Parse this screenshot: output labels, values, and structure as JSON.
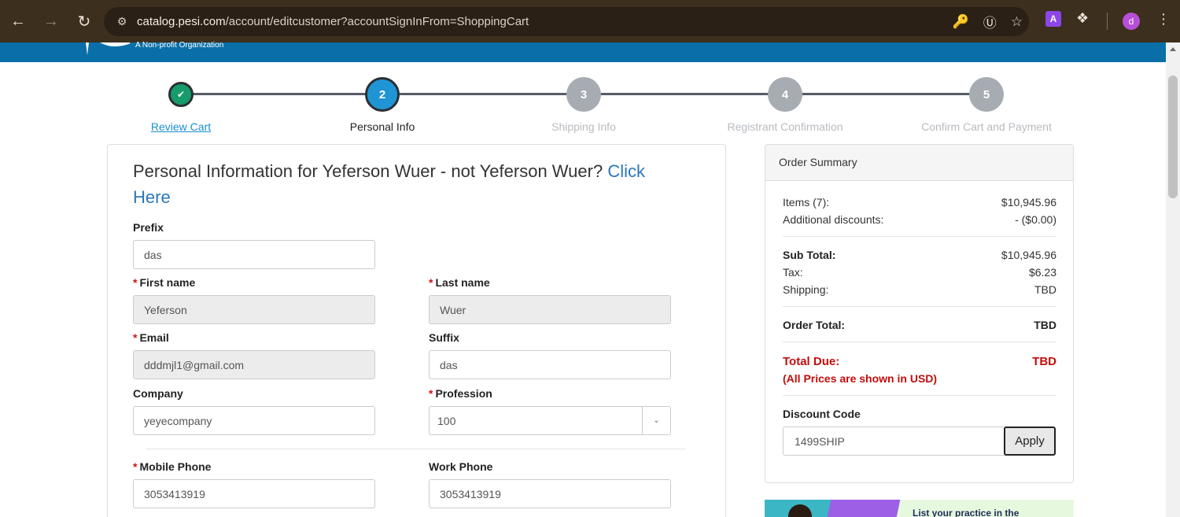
{
  "browser": {
    "url_host": "catalog.pesi.com",
    "url_path": "/account/editcustomer?accountSignInFrom=ShoppingCart",
    "profile_initial": "d",
    "extension_letter": "A"
  },
  "site": {
    "tagline": "A Non-profit Organization"
  },
  "steps": [
    {
      "number": "✔",
      "label": "Review Cart",
      "state": "done"
    },
    {
      "number": "2",
      "label": "Personal Info",
      "state": "active"
    },
    {
      "number": "3",
      "label": "Shipping Info",
      "state": "todo"
    },
    {
      "number": "4",
      "label": "Registrant Confirmation",
      "state": "todo"
    },
    {
      "number": "5",
      "label": "Confirm Cart and Payment",
      "state": "todo"
    }
  ],
  "form": {
    "title": "Personal Information for Yeferson Wuer - not Yeferson Wuer?",
    "title_link": "Click Here",
    "prefix_label": "Prefix",
    "prefix_value": "das",
    "first_name_label": "First name",
    "first_name_value": "Yeferson",
    "last_name_label": "Last name",
    "last_name_value": "Wuer",
    "email_label": "Email",
    "email_value": "dddmjl1@gmail.com",
    "suffix_label": "Suffix",
    "suffix_value": "das",
    "company_label": "Company",
    "company_value": "yeyecompany",
    "profession_label": "Profession",
    "profession_value": "100",
    "mobile_label": "Mobile Phone",
    "mobile_value": "3053413919",
    "work_label": "Work Phone",
    "work_value": "3053413919",
    "required_mark": "*"
  },
  "summary": {
    "title": "Order Summary",
    "items_label": "Items (7):",
    "items_value": "$10,945.96",
    "discounts_label": "Additional discounts:",
    "discounts_value": "- ($0.00)",
    "subtotal_label": "Sub Total:",
    "subtotal_value": "$10,945.96",
    "tax_label": "Tax:",
    "tax_value": "$6.23",
    "shipping_label": "Shipping:",
    "shipping_value": "TBD",
    "order_total_label": "Order Total:",
    "order_total_value": "TBD",
    "total_due_label": "Total Due:",
    "total_due_value": "TBD",
    "usd_note": "(All Prices are shown in USD)",
    "discount_label": "Discount Code",
    "discount_value": "1499SHIP",
    "apply_label": "Apply"
  },
  "ad": {
    "text": "List your practice in the"
  }
}
